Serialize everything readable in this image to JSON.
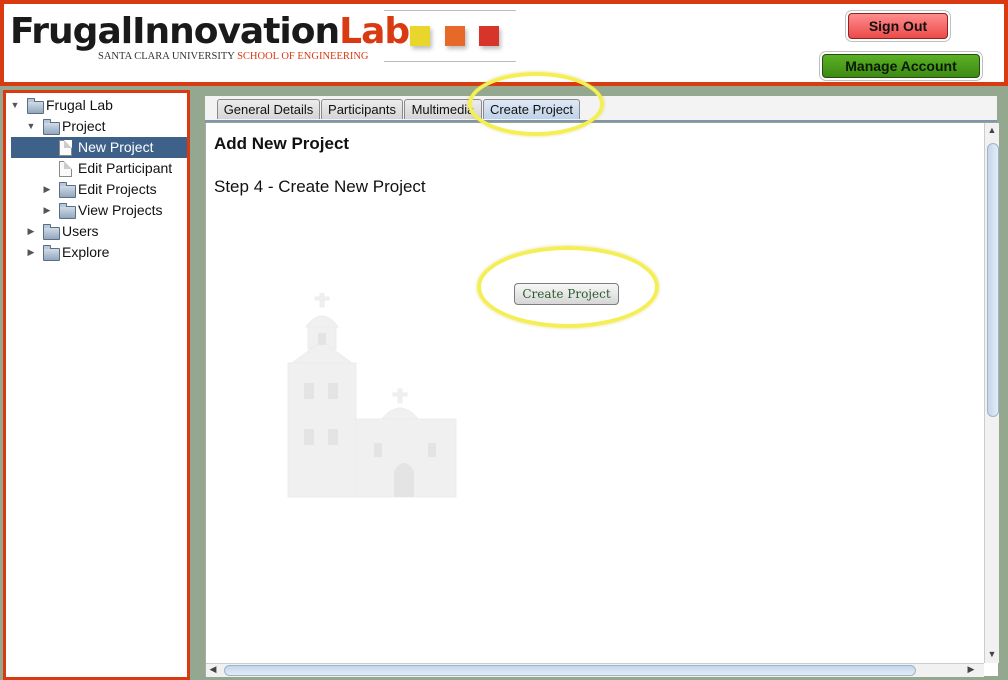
{
  "header": {
    "logo_part1": "FrugalInnovation",
    "logo_part2": "Lab",
    "logo_sub1": "SANTA CLARA UNIVERSITY",
    "logo_sub2": "SCHOOL OF ENGINEERING",
    "swatch_colors": [
      "#e8d62a",
      "#e7692a",
      "#d7352a"
    ],
    "signout_label": "Sign Out",
    "manage_label": "Manage Account"
  },
  "sidebar": {
    "items": [
      {
        "label": "Frugal Lab",
        "icon": "folder-icon",
        "expanded": true
      },
      {
        "label": "Project",
        "icon": "folder-icon",
        "expanded": true
      },
      {
        "label": "New Project",
        "icon": "document-icon",
        "selected": true
      },
      {
        "label": "Edit Participant",
        "icon": "document-icon"
      },
      {
        "label": "Edit Projects",
        "icon": "folder-icon",
        "expanded": false
      },
      {
        "label": "View Projects",
        "icon": "folder-icon",
        "expanded": false
      },
      {
        "label": "Users",
        "icon": "folder-icon",
        "expanded": false
      },
      {
        "label": "Explore",
        "icon": "folder-icon",
        "expanded": false
      }
    ]
  },
  "tabs": [
    {
      "label": "General Details"
    },
    {
      "label": "Participants"
    },
    {
      "label": "Multimedia"
    },
    {
      "label": "Create Project",
      "active": true
    }
  ],
  "main": {
    "title": "Add New Project",
    "step": "Step 4 - Create New Project",
    "create_button": "Create Project"
  },
  "colors": {
    "accent_border": "#d93a12",
    "selection": "#3d6189",
    "highlight_circle": "#f4ef55",
    "signout_red": "#ec4a4a",
    "manage_green": "#3d8a14"
  }
}
